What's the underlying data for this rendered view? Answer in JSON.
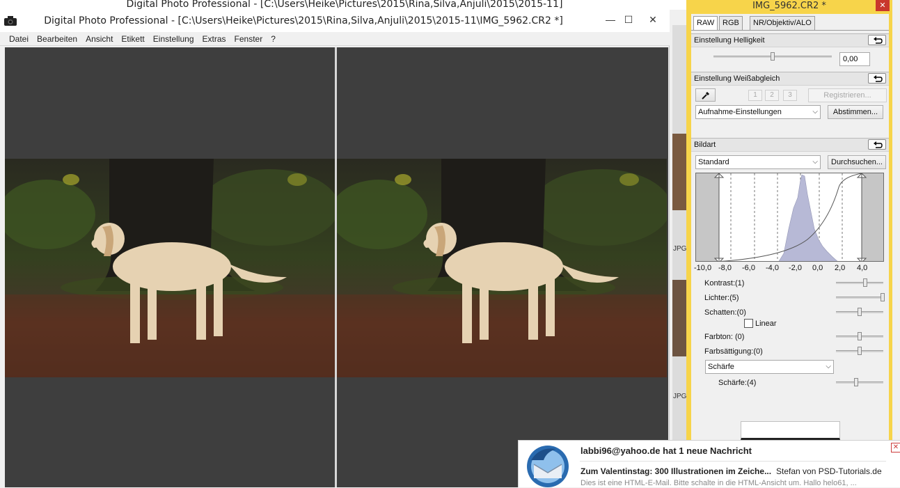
{
  "background_window": {
    "title": "Digital Photo Professional - [C:\\Users\\Heike\\Pictures\\2015\\Rina,Silva,Anjuli\\2015\\2015-11]",
    "side_labels": [
      "JPG",
      "JPG"
    ]
  },
  "main_window": {
    "title": "Digital Photo Professional - [C:\\Users\\Heike\\Pictures\\2015\\Rina,Silva,Anjuli\\2015\\2015-11\\IMG_5962.CR2 *]",
    "controls": {
      "minimize": "—",
      "maximize": "☐",
      "close": "✕"
    },
    "menu": [
      "Datei",
      "Bearbeiten",
      "Ansicht",
      "Etikett",
      "Einstellung",
      "Extras",
      "Fenster",
      "?"
    ]
  },
  "palette": {
    "title": "IMG_5962.CR2 *",
    "close": "✕",
    "tabs": [
      "RAW",
      "RGB",
      "NR/Objektiv/ALO"
    ],
    "active_tab": "RAW",
    "brightness": {
      "header": "Einstellung Helligkeit",
      "value": "0,00",
      "slider_fraction": 0.5
    },
    "white_balance": {
      "header": "Einstellung Weißabgleich",
      "slots": [
        "1",
        "2",
        "3"
      ],
      "register": "Registrieren...",
      "preset": "Aufnahme-Einstellungen",
      "tune": "Abstimmen..."
    },
    "picture_style": {
      "header": "Bildart",
      "preset": "Standard",
      "browse": "Durchsuchen...",
      "scale": [
        "-10,0",
        "-8,0",
        "-6,0",
        "-4,0",
        "-2,0",
        "0,0",
        "2,0",
        "4,0"
      ],
      "sliders": [
        {
          "label": "Kontrast:(1)",
          "fraction": 0.62
        },
        {
          "label": "Lichter:(5)",
          "fraction": 0.98
        },
        {
          "label": "Schatten:(0)",
          "fraction": 0.5
        },
        {
          "label": "Farbton: (0)",
          "fraction": 0.5
        },
        {
          "label": "Farbsättigung:(0)",
          "fraction": 0.5
        }
      ],
      "linear_label": "Linear",
      "sharpness_mode": "Schärfe",
      "sharpness": {
        "label": "Schärfe:(4)",
        "fraction": 0.42
      }
    }
  },
  "notification": {
    "header": "labbi96@yahoo.de hat 1 neue Nachricht",
    "subject": "Zum Valentinstag: 300 Illustrationen im Zeiche...",
    "sender": "Stefan von PSD-Tutorials.de",
    "preview": "Dies ist eine HTML-E-Mail. Bitte schalte in die HTML-Ansicht um. Hallo helo61, ...",
    "close": "✕"
  },
  "colors": {
    "palette_border": "#f7d44a",
    "viewer_bg": "#3e3e3e",
    "histogram_fill": "#b7b9d6"
  }
}
